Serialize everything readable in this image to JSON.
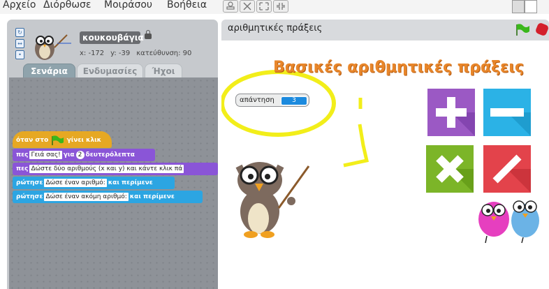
{
  "menu": {
    "items": [
      "Αρχείο",
      "Διόρθωσε",
      "Μοιράσου",
      "Βοήθεια"
    ]
  },
  "toolbar": {
    "icons": [
      "stamp-icon",
      "scissors-icon",
      "grow-icon",
      "shrink-icon"
    ],
    "layout_icons": [
      "small-stage-icon",
      "normal-stage-icon"
    ]
  },
  "sprite": {
    "name": "κουκουβάγια",
    "x": "x: -172",
    "y": "y: -39",
    "direction": "κατεύθυνση: 90"
  },
  "tabs": [
    {
      "label": "Σενάρια",
      "active": true
    },
    {
      "label": "Ενδυμασίες",
      "active": false
    },
    {
      "label": "Ήχοι",
      "active": false
    }
  ],
  "script": {
    "hat": {
      "prefix": "όταν στο",
      "suffix": "γίνει κλικ"
    },
    "blocks": [
      {
        "kind": "looks",
        "cmd": "πες",
        "arg": "Γειά σας!",
        "mid": "για",
        "num": "2",
        "tail": "δευτερόλεπτα"
      },
      {
        "kind": "looks",
        "cmd": "πες",
        "arg": "Δώστε δύο αριθμούς (x και y) και κάντε κλικ πά"
      },
      {
        "kind": "sensing",
        "cmd": "ρώτησε",
        "arg": "Δώσε έναν αριθμό:",
        "tail": "και περίμενε"
      },
      {
        "kind": "sensing",
        "cmd": "ρώτησε",
        "arg": "Δώσε έναν ακόμη αριθμό:",
        "tail": "και περίμενε"
      }
    ]
  },
  "stage": {
    "title": "αριθμητικές πράξεις",
    "heading": "Βασικές αριθμητικές πράξεις",
    "monitor": {
      "label": "απάντηση",
      "value": "3"
    },
    "operations": [
      "plus-button",
      "minus-button",
      "times-button",
      "divide-button"
    ]
  },
  "colors": {
    "heading": "#e8862a",
    "hat_block": "#e6a823",
    "looks_block": "#8a55d7",
    "sensing_block": "#2ca5e2",
    "plus": "#9b59c4",
    "minus": "#2bb2e6",
    "times": "#7cb528",
    "divide": "#e3434b",
    "highlight": "#f2ee1a"
  }
}
